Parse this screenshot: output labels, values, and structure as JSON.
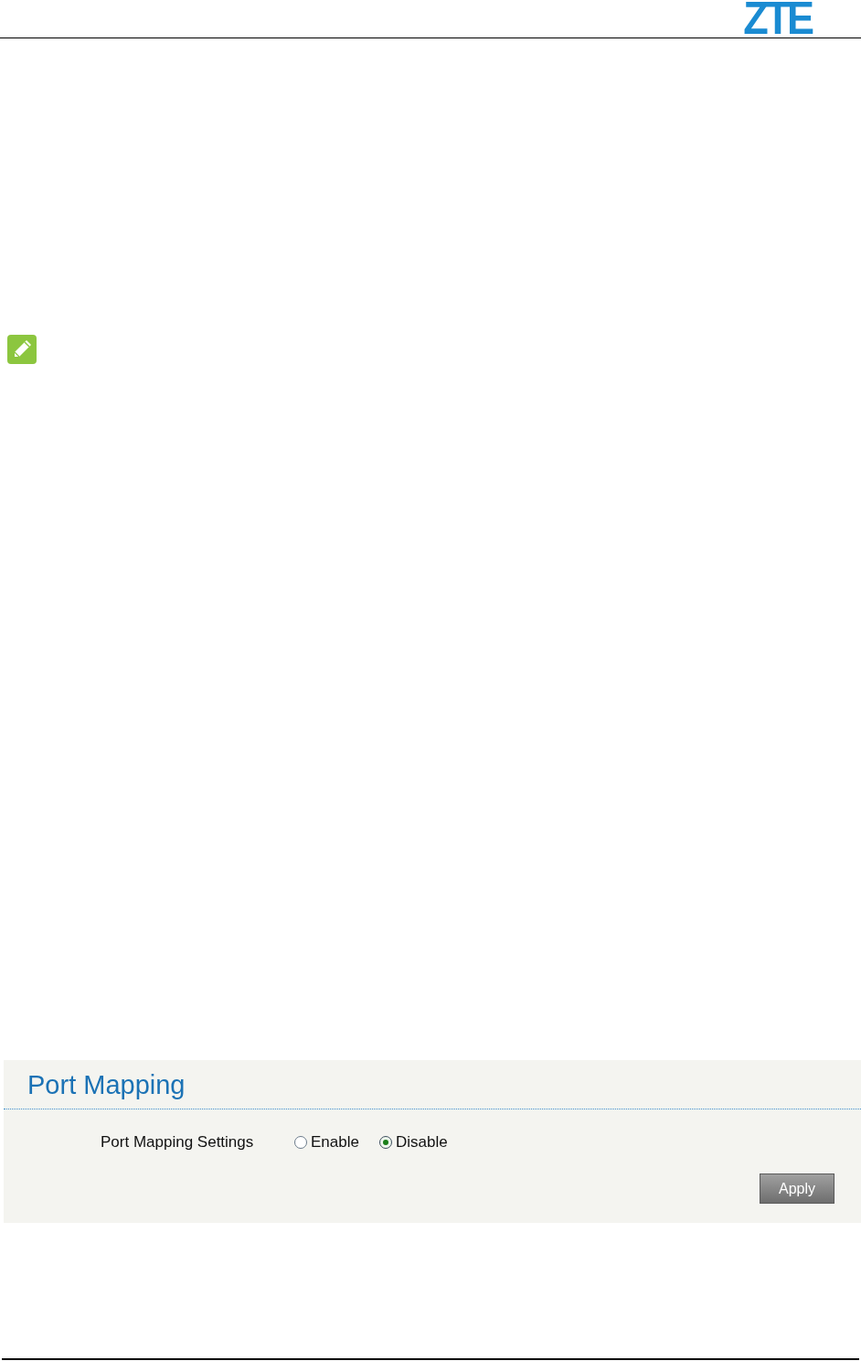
{
  "header": {
    "logo": "ZTE"
  },
  "panel": {
    "title": "Port Mapping",
    "setting": {
      "label": "Port Mapping Settings",
      "options": [
        {
          "label": "Enable",
          "selected": false
        },
        {
          "label": "Disable",
          "selected": true
        }
      ]
    },
    "button": "Apply"
  }
}
